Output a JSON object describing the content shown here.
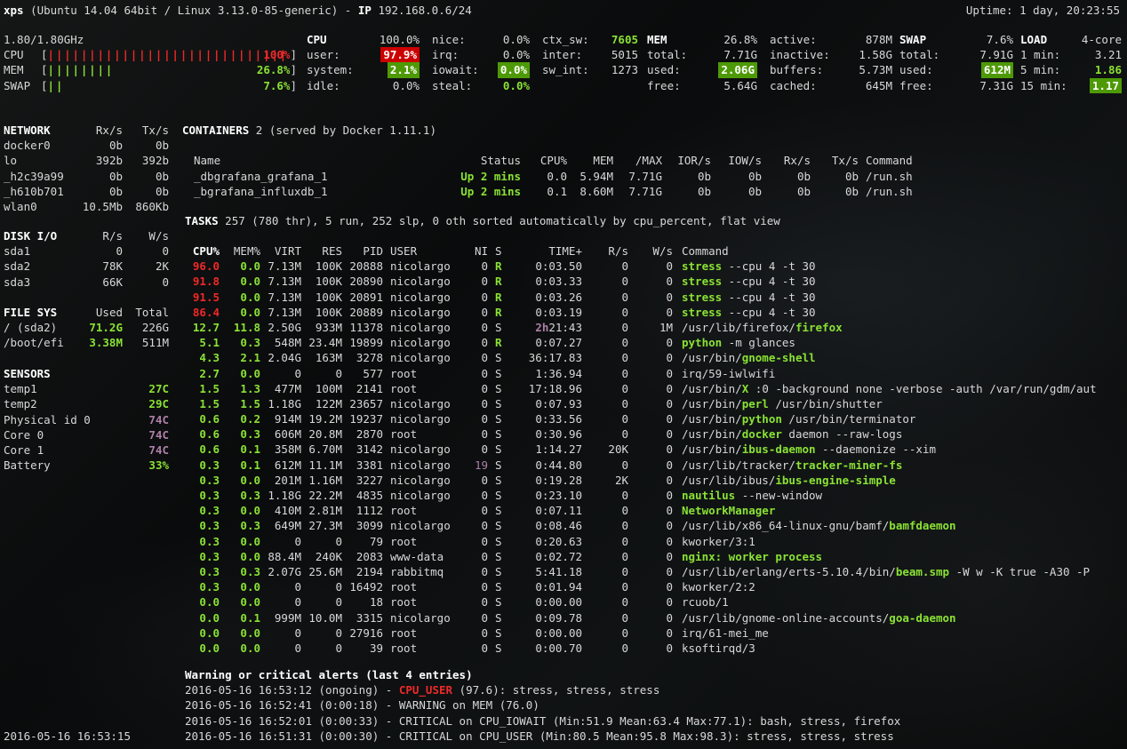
{
  "header": {
    "host": "xps",
    "title_rest": " (Ubuntu 14.04 64bit / Linux 3.13.0-85-generic) - ",
    "ip_label": "IP",
    "ip_value": " 192.168.0.6/24",
    "uptime": "Uptime: 1 day, 20:23:55"
  },
  "quicklook": {
    "freq": "1.80/1.80GHz",
    "rows": [
      {
        "label": "CPU",
        "bars": 31,
        "pct": "100%",
        "color": "red"
      },
      {
        "label": "MEM",
        "bars": 8,
        "pct": "26.8%",
        "color": "green"
      },
      {
        "label": "SWAP",
        "bars": 2,
        "pct": "7.6%",
        "color": "green"
      }
    ]
  },
  "panels": {
    "cpu": {
      "rows": [
        [
          [
            "CPU",
            "100.0%",
            "kb",
            ""
          ],
          [
            "nice:",
            "0.0%",
            "",
            ""
          ],
          [
            "ctx_sw:",
            "7605",
            "",
            "gb"
          ]
        ],
        [
          [
            "user:",
            "97.9%",
            "",
            "bgr"
          ],
          [
            "irq:",
            "0.0%",
            "",
            ""
          ],
          [
            "inter:",
            "5015",
            "",
            ""
          ]
        ],
        [
          [
            "system:",
            "2.1%",
            "",
            "bgg"
          ],
          [
            "iowait:",
            "0.0%",
            "",
            "bgg"
          ],
          [
            "sw_int:",
            "1273",
            "",
            ""
          ]
        ],
        [
          [
            "idle:",
            "0.0%",
            "",
            ""
          ],
          [
            "steal:",
            "0.0%",
            "",
            "gb"
          ]
        ]
      ]
    },
    "mem": {
      "rows": [
        [
          [
            "MEM",
            "26.8%",
            "kb",
            ""
          ],
          [
            "active:",
            "878M",
            "",
            ""
          ]
        ],
        [
          [
            "total:",
            "7.71G",
            "",
            ""
          ],
          [
            "inactive:",
            "1.58G",
            "",
            ""
          ]
        ],
        [
          [
            "used:",
            "2.06G",
            "",
            "bgg"
          ],
          [
            "buffers:",
            "5.73M",
            "",
            ""
          ]
        ],
        [
          [
            "free:",
            "5.64G",
            "",
            ""
          ],
          [
            "cached:",
            "645M",
            "",
            ""
          ]
        ]
      ]
    },
    "swap": {
      "rows": [
        [
          [
            "SWAP",
            "7.6%",
            "kb",
            ""
          ]
        ],
        [
          [
            "total:",
            "7.91G",
            "",
            ""
          ]
        ],
        [
          [
            "used:",
            "612M",
            "",
            "bgg"
          ]
        ],
        [
          [
            "free:",
            "7.31G",
            "",
            ""
          ]
        ]
      ]
    },
    "load": {
      "rows": [
        [
          [
            "LOAD",
            "4-core",
            "kb",
            ""
          ]
        ],
        [
          [
            "1 min:",
            "3.21",
            "",
            ""
          ]
        ],
        [
          [
            "5 min:",
            "1.86",
            "",
            "gb"
          ]
        ],
        [
          [
            "15 min:",
            "1.17",
            "",
            "bgg"
          ]
        ]
      ]
    }
  },
  "network": {
    "title": "NETWORK",
    "col1": "Rx/s",
    "col2": "Tx/s",
    "rows": [
      [
        "docker0",
        "0b",
        "0b",
        "",
        ""
      ],
      [
        "lo",
        "392b",
        "392b",
        "",
        ""
      ],
      [
        "_h2c39a99",
        "0b",
        "0b",
        "",
        ""
      ],
      [
        "_h610b701",
        "0b",
        "0b",
        "",
        ""
      ],
      [
        "wlan0",
        "10.5Mb",
        "860Kb",
        "",
        ""
      ]
    ]
  },
  "diskio": {
    "title": "DISK I/O",
    "col1": "R/s",
    "col2": "W/s",
    "rows": [
      [
        "sda1",
        "0",
        "0",
        "",
        ""
      ],
      [
        "sda2",
        "78K",
        "2K",
        "",
        ""
      ],
      [
        "sda3",
        "66K",
        "0",
        "",
        ""
      ]
    ]
  },
  "filesys": {
    "title": "FILE SYS",
    "col1": "Used",
    "col2": "Total",
    "rows": [
      [
        "/ (sda2)",
        "71.2G",
        "226G",
        "gb",
        ""
      ],
      [
        "/boot/efi",
        "3.38M",
        "511M",
        "gb",
        ""
      ]
    ]
  },
  "sensors": {
    "title": "SENSORS",
    "rows": [
      [
        "temp1",
        "27C",
        "gb"
      ],
      [
        "temp2",
        "29C",
        "gb"
      ],
      [
        "Physical id 0",
        "74C",
        "mb"
      ],
      [
        "Core 0",
        "74C",
        "mb"
      ],
      [
        "Core 1",
        "74C",
        "mb"
      ],
      [
        "Battery",
        "33%",
        "gb"
      ]
    ]
  },
  "containers": {
    "title": "CONTAINERS",
    "subtitle": " 2 (served by Docker 1.11.1)",
    "headers": [
      "Name",
      "Status",
      "CPU%",
      "MEM",
      "/MAX",
      "IOR/s",
      "IOW/s",
      "Rx/s",
      "Tx/s",
      "Command"
    ],
    "rows": [
      {
        "name": "_dbgrafana_grafana_1",
        "status": "Up 2 mins",
        "cpu": "0.0",
        "mem": "5.94M",
        "max": "7.71G",
        "ior": "0b",
        "iow": "0b",
        "rx": "0b",
        "tx": "0b",
        "cmd": "/run.sh"
      },
      {
        "name": "_bgrafana_influxdb_1",
        "status": "Up 2 mins",
        "cpu": "0.1",
        "mem": "8.60M",
        "max": "7.71G",
        "ior": "0b",
        "iow": "0b",
        "rx": "0b",
        "tx": "0b",
        "cmd": "/run.sh"
      }
    ]
  },
  "tasks": {
    "title": "TASKS",
    "rest": " 257 (780 thr), 5 run, 252 slp, 0 oth sorted automatically by cpu_percent, flat view"
  },
  "process": {
    "headers": [
      "CPU%",
      "MEM%",
      "VIRT",
      "RES",
      "PID",
      "USER",
      "NI",
      "S",
      "TIME+",
      "R/s",
      "W/s",
      "Command"
    ],
    "rows": [
      {
        "cpu": "96.0",
        "cpuc": "red",
        "mem": "0.0",
        "virt": "7.13M",
        "res": "100K",
        "pid": "20888",
        "user": "nicolargo",
        "ni": "0",
        "nic": "",
        "s": "R",
        "sc": "gb",
        "timeh": "",
        "time": "0:03.50",
        "rs": "0",
        "ws": "0",
        "cmd": [
          "",
          "stress",
          " --cpu 4 -t 30"
        ]
      },
      {
        "cpu": "91.8",
        "cpuc": "red",
        "mem": "0.0",
        "virt": "7.13M",
        "res": "100K",
        "pid": "20890",
        "user": "nicolargo",
        "ni": "0",
        "nic": "",
        "s": "R",
        "sc": "gb",
        "timeh": "",
        "time": "0:03.33",
        "rs": "0",
        "ws": "0",
        "cmd": [
          "",
          "stress",
          " --cpu 4 -t 30"
        ]
      },
      {
        "cpu": "91.5",
        "cpuc": "red",
        "mem": "0.0",
        "virt": "7.13M",
        "res": "100K",
        "pid": "20891",
        "user": "nicolargo",
        "ni": "0",
        "nic": "",
        "s": "R",
        "sc": "gb",
        "timeh": "",
        "time": "0:03.26",
        "rs": "0",
        "ws": "0",
        "cmd": [
          "",
          "stress",
          " --cpu 4 -t 30"
        ]
      },
      {
        "cpu": "86.4",
        "cpuc": "red",
        "mem": "0.0",
        "virt": "7.13M",
        "res": "100K",
        "pid": "20889",
        "user": "nicolargo",
        "ni": "0",
        "nic": "",
        "s": "R",
        "sc": "gb",
        "timeh": "",
        "time": "0:03.19",
        "rs": "0",
        "ws": "0",
        "cmd": [
          "",
          "stress",
          " --cpu 4 -t 30"
        ]
      },
      {
        "cpu": "12.7",
        "cpuc": "green",
        "mem": "11.8",
        "virt": "2.50G",
        "res": "933M",
        "pid": "11378",
        "user": "nicolargo",
        "ni": "0",
        "nic": "",
        "s": "S",
        "sc": "",
        "timeh": "2h",
        "time": "21:43",
        "rs": "0",
        "ws": "1M",
        "cmd": [
          "/usr/lib/firefox/",
          "firefox",
          ""
        ]
      },
      {
        "cpu": "5.1",
        "cpuc": "green",
        "mem": "0.3",
        "virt": "548M",
        "res": "23.4M",
        "pid": "19899",
        "user": "nicolargo",
        "ni": "0",
        "nic": "",
        "s": "R",
        "sc": "gb",
        "timeh": "",
        "time": "0:07.27",
        "rs": "0",
        "ws": "0",
        "cmd": [
          "",
          "python",
          " -m glances"
        ]
      },
      {
        "cpu": "4.3",
        "cpuc": "green",
        "mem": "2.1",
        "virt": "2.04G",
        "res": "163M",
        "pid": "3278",
        "user": "nicolargo",
        "ni": "0",
        "nic": "",
        "s": "S",
        "sc": "",
        "timeh": "",
        "time": "36:17.83",
        "rs": "0",
        "ws": "0",
        "cmd": [
          "/usr/bin/",
          "gnome-shell",
          ""
        ]
      },
      {
        "cpu": "2.7",
        "cpuc": "green",
        "mem": "0.0",
        "virt": "0",
        "res": "0",
        "pid": "577",
        "user": "root",
        "ni": "0",
        "nic": "",
        "s": "S",
        "sc": "",
        "timeh": "",
        "time": "1:36.94",
        "rs": "0",
        "ws": "0",
        "cmd": [
          "irq/59-iwlwifi",
          "",
          ""
        ]
      },
      {
        "cpu": "1.5",
        "cpuc": "green",
        "mem": "1.3",
        "virt": "477M",
        "res": "100M",
        "pid": "2141",
        "user": "root",
        "ni": "0",
        "nic": "",
        "s": "S",
        "sc": "",
        "timeh": "",
        "time": "17:18.96",
        "rs": "0",
        "ws": "0",
        "cmd": [
          "/usr/bin/",
          "X",
          " :0 -background none -verbose -auth /var/run/gdm/aut"
        ]
      },
      {
        "cpu": "1.5",
        "cpuc": "green",
        "mem": "1.5",
        "virt": "1.18G",
        "res": "122M",
        "pid": "23657",
        "user": "nicolargo",
        "ni": "0",
        "nic": "",
        "s": "S",
        "sc": "",
        "timeh": "",
        "time": "0:07.93",
        "rs": "0",
        "ws": "0",
        "cmd": [
          "/usr/bin/",
          "perl",
          " /usr/bin/shutter"
        ]
      },
      {
        "cpu": "0.6",
        "cpuc": "green",
        "mem": "0.2",
        "virt": "914M",
        "res": "19.2M",
        "pid": "19237",
        "user": "nicolargo",
        "ni": "0",
        "nic": "",
        "s": "S",
        "sc": "",
        "timeh": "",
        "time": "0:33.56",
        "rs": "0",
        "ws": "0",
        "cmd": [
          "/usr/bin/",
          "python",
          " /usr/bin/terminator"
        ]
      },
      {
        "cpu": "0.6",
        "cpuc": "green",
        "mem": "0.3",
        "virt": "606M",
        "res": "20.8M",
        "pid": "2870",
        "user": "root",
        "ni": "0",
        "nic": "",
        "s": "S",
        "sc": "",
        "timeh": "",
        "time": "0:30.96",
        "rs": "0",
        "ws": "0",
        "cmd": [
          "/usr/bin/",
          "docker",
          " daemon --raw-logs"
        ]
      },
      {
        "cpu": "0.6",
        "cpuc": "green",
        "mem": "0.1",
        "virt": "358M",
        "res": "6.70M",
        "pid": "3142",
        "user": "nicolargo",
        "ni": "0",
        "nic": "",
        "s": "S",
        "sc": "",
        "timeh": "",
        "time": "1:14.27",
        "rs": "20K",
        "ws": "0",
        "cmd": [
          "/usr/bin/",
          "ibus-daemon",
          " --daemonize --xim"
        ]
      },
      {
        "cpu": "0.3",
        "cpuc": "green",
        "mem": "0.1",
        "virt": "612M",
        "res": "11.1M",
        "pid": "3381",
        "user": "nicolargo",
        "ni": "19",
        "nic": "m",
        "s": "S",
        "sc": "",
        "timeh": "",
        "time": "0:44.80",
        "rs": "0",
        "ws": "0",
        "cmd": [
          "/usr/lib/tracker/",
          "tracker-miner-fs",
          ""
        ]
      },
      {
        "cpu": "0.3",
        "cpuc": "green",
        "mem": "0.0",
        "virt": "201M",
        "res": "1.16M",
        "pid": "3227",
        "user": "nicolargo",
        "ni": "0",
        "nic": "",
        "s": "S",
        "sc": "",
        "timeh": "",
        "time": "0:19.28",
        "rs": "2K",
        "ws": "0",
        "cmd": [
          "/usr/lib/ibus/",
          "ibus-engine-simple",
          ""
        ]
      },
      {
        "cpu": "0.3",
        "cpuc": "green",
        "mem": "0.3",
        "virt": "1.18G",
        "res": "22.2M",
        "pid": "4835",
        "user": "nicolargo",
        "ni": "0",
        "nic": "",
        "s": "S",
        "sc": "",
        "timeh": "",
        "time": "0:23.10",
        "rs": "0",
        "ws": "0",
        "cmd": [
          "",
          "nautilus",
          " --new-window"
        ]
      },
      {
        "cpu": "0.3",
        "cpuc": "green",
        "mem": "0.0",
        "virt": "410M",
        "res": "2.81M",
        "pid": "1112",
        "user": "root",
        "ni": "0",
        "nic": "",
        "s": "S",
        "sc": "",
        "timeh": "",
        "time": "0:07.11",
        "rs": "0",
        "ws": "0",
        "cmd": [
          "",
          "NetworkManager",
          ""
        ]
      },
      {
        "cpu": "0.3",
        "cpuc": "green",
        "mem": "0.3",
        "virt": "649M",
        "res": "27.3M",
        "pid": "3099",
        "user": "nicolargo",
        "ni": "0",
        "nic": "",
        "s": "S",
        "sc": "",
        "timeh": "",
        "time": "0:08.46",
        "rs": "0",
        "ws": "0",
        "cmd": [
          "/usr/lib/x86_64-linux-gnu/bamf/",
          "bamfdaemon",
          ""
        ]
      },
      {
        "cpu": "0.3",
        "cpuc": "green",
        "mem": "0.0",
        "virt": "0",
        "res": "0",
        "pid": "79",
        "user": "root",
        "ni": "0",
        "nic": "",
        "s": "S",
        "sc": "",
        "timeh": "",
        "time": "0:20.63",
        "rs": "0",
        "ws": "0",
        "cmd": [
          "kworker/3:1",
          "",
          ""
        ]
      },
      {
        "cpu": "0.3",
        "cpuc": "green",
        "mem": "0.0",
        "virt": "88.4M",
        "res": "240K",
        "pid": "2083",
        "user": "www-data",
        "ni": "0",
        "nic": "",
        "s": "S",
        "sc": "",
        "timeh": "",
        "time": "0:02.72",
        "rs": "0",
        "ws": "0",
        "cmd": [
          "",
          "nginx: worker process",
          ""
        ]
      },
      {
        "cpu": "0.3",
        "cpuc": "green",
        "mem": "0.3",
        "virt": "2.07G",
        "res": "25.6M",
        "pid": "2194",
        "user": "rabbitmq",
        "ni": "0",
        "nic": "",
        "s": "S",
        "sc": "",
        "timeh": "",
        "time": "5:41.18",
        "rs": "0",
        "ws": "0",
        "cmd": [
          "/usr/lib/erlang/erts-5.10.4/bin/",
          "beam.smp",
          " -W w -K true -A30 -P"
        ]
      },
      {
        "cpu": "0.3",
        "cpuc": "green",
        "mem": "0.0",
        "virt": "0",
        "res": "0",
        "pid": "16492",
        "user": "root",
        "ni": "0",
        "nic": "",
        "s": "S",
        "sc": "",
        "timeh": "",
        "time": "0:01.94",
        "rs": "0",
        "ws": "0",
        "cmd": [
          "kworker/2:2",
          "",
          ""
        ]
      },
      {
        "cpu": "0.0",
        "cpuc": "green",
        "mem": "0.0",
        "virt": "0",
        "res": "0",
        "pid": "18",
        "user": "root",
        "ni": "0",
        "nic": "",
        "s": "S",
        "sc": "",
        "timeh": "",
        "time": "0:00.00",
        "rs": "0",
        "ws": "0",
        "cmd": [
          "rcuob/1",
          "",
          ""
        ]
      },
      {
        "cpu": "0.0",
        "cpuc": "green",
        "mem": "0.1",
        "virt": "999M",
        "res": "10.0M",
        "pid": "3315",
        "user": "nicolargo",
        "ni": "0",
        "nic": "",
        "s": "S",
        "sc": "",
        "timeh": "",
        "time": "0:09.78",
        "rs": "0",
        "ws": "0",
        "cmd": [
          "/usr/lib/gnome-online-accounts/",
          "goa-daemon",
          ""
        ]
      },
      {
        "cpu": "0.0",
        "cpuc": "green",
        "mem": "0.0",
        "virt": "0",
        "res": "0",
        "pid": "27916",
        "user": "root",
        "ni": "0",
        "nic": "",
        "s": "S",
        "sc": "",
        "timeh": "",
        "time": "0:00.00",
        "rs": "0",
        "ws": "0",
        "cmd": [
          "irq/61-mei_me",
          "",
          ""
        ]
      },
      {
        "cpu": "0.0",
        "cpuc": "green",
        "mem": "0.0",
        "virt": "0",
        "res": "0",
        "pid": "39",
        "user": "root",
        "ni": "0",
        "nic": "",
        "s": "S",
        "sc": "",
        "timeh": "",
        "time": "0:00.70",
        "rs": "0",
        "ws": "0",
        "cmd": [
          "ksoftirqd/3",
          "",
          ""
        ]
      }
    ]
  },
  "alerts": {
    "title": "Warning or critical alerts (last 4 entries)",
    "lines": [
      {
        "pre": "2016-05-16 16:53:12 (ongoing) - ",
        "hl": "CPU_USER",
        "post": " (97.6): stress, stress, stress"
      },
      {
        "pre": "2016-05-16 16:52:41 (0:00:18) - WARNING on MEM (76.0)",
        "hl": "",
        "post": ""
      },
      {
        "pre": "2016-05-16 16:52:01 (0:00:33) - CRITICAL on CPU_IOWAIT (Min:51.9 Mean:63.4 Max:77.1): bash, stress, firefox",
        "hl": "",
        "post": ""
      },
      {
        "pre": "2016-05-16 16:51:31 (0:00:30) - CRITICAL on CPU_USER (Min:80.5 Mean:95.8 Max:98.3): stress, stress, stress",
        "hl": "",
        "post": ""
      }
    ]
  },
  "footer": {
    "time": "2016-05-16 16:53:15"
  },
  "colors": {
    "green": "#8ae234",
    "red": "#ef2929",
    "magenta": "#ad7fa8",
    "ok_bg": "#4e9a06",
    "critical_bg": "#cc0000",
    "text": "#d8d8d8"
  }
}
